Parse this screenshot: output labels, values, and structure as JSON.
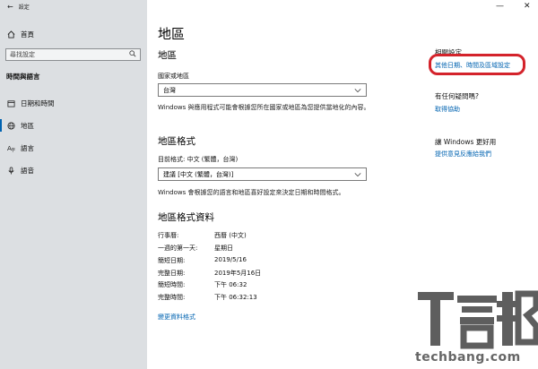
{
  "window": {
    "title": "設定",
    "minimize": "—",
    "close": "✕"
  },
  "sidebar": {
    "home_label": "首頁",
    "search_placeholder": "尋找設定",
    "section_title": "時間與語言",
    "items": [
      {
        "label": "日期和時間",
        "icon": "calendar-clock-icon"
      },
      {
        "label": "地區",
        "icon": "globe-icon",
        "active": true
      },
      {
        "label": "語言",
        "icon": "language-icon"
      },
      {
        "label": "語音",
        "icon": "microphone-icon"
      }
    ]
  },
  "main": {
    "title": "地區",
    "region": {
      "heading": "地區",
      "label": "國家或地區",
      "selected": "台灣",
      "description": "Windows 與應用程式可能會根據您所在國家或地區為您提供當地化的內容。"
    },
    "format": {
      "heading": "地區格式",
      "current_label": "目前格式: 中文 (繁體，台灣)",
      "selected": "建議 [中文 (繁體，台灣)]",
      "description": "Windows 會根據您的語言和地區喜好設定來決定日期和時間格式。"
    },
    "format_data": {
      "heading": "地區格式資料",
      "rows": [
        {
          "label": "行事曆:",
          "value": "西曆 (中文)"
        },
        {
          "label": "一週的第一天:",
          "value": "星期日"
        },
        {
          "label": "簡短日期:",
          "value": "2019/5/16"
        },
        {
          "label": "完整日期:",
          "value": "2019年5月16日"
        },
        {
          "label": "簡短時間:",
          "value": "下午 06:32"
        },
        {
          "label": "完整時間:",
          "value": "下午 06:32:13"
        }
      ],
      "change_link": "變更資料格式"
    }
  },
  "related": {
    "heading": "相關設定",
    "link": "其他日期、時間及區域設定",
    "highlight_color": "#d4232b"
  },
  "help": {
    "heading": "有任何疑問嗎?",
    "link": "取得協助"
  },
  "improve": {
    "heading": "讓 Windows 更好用",
    "link": "提供意見反應給我們"
  },
  "watermark": {
    "logo_text": "T客邦",
    "url": "techbang.com"
  },
  "colors": {
    "accent": "#0063b1",
    "sidebar_bg": "#dcdfe2"
  }
}
